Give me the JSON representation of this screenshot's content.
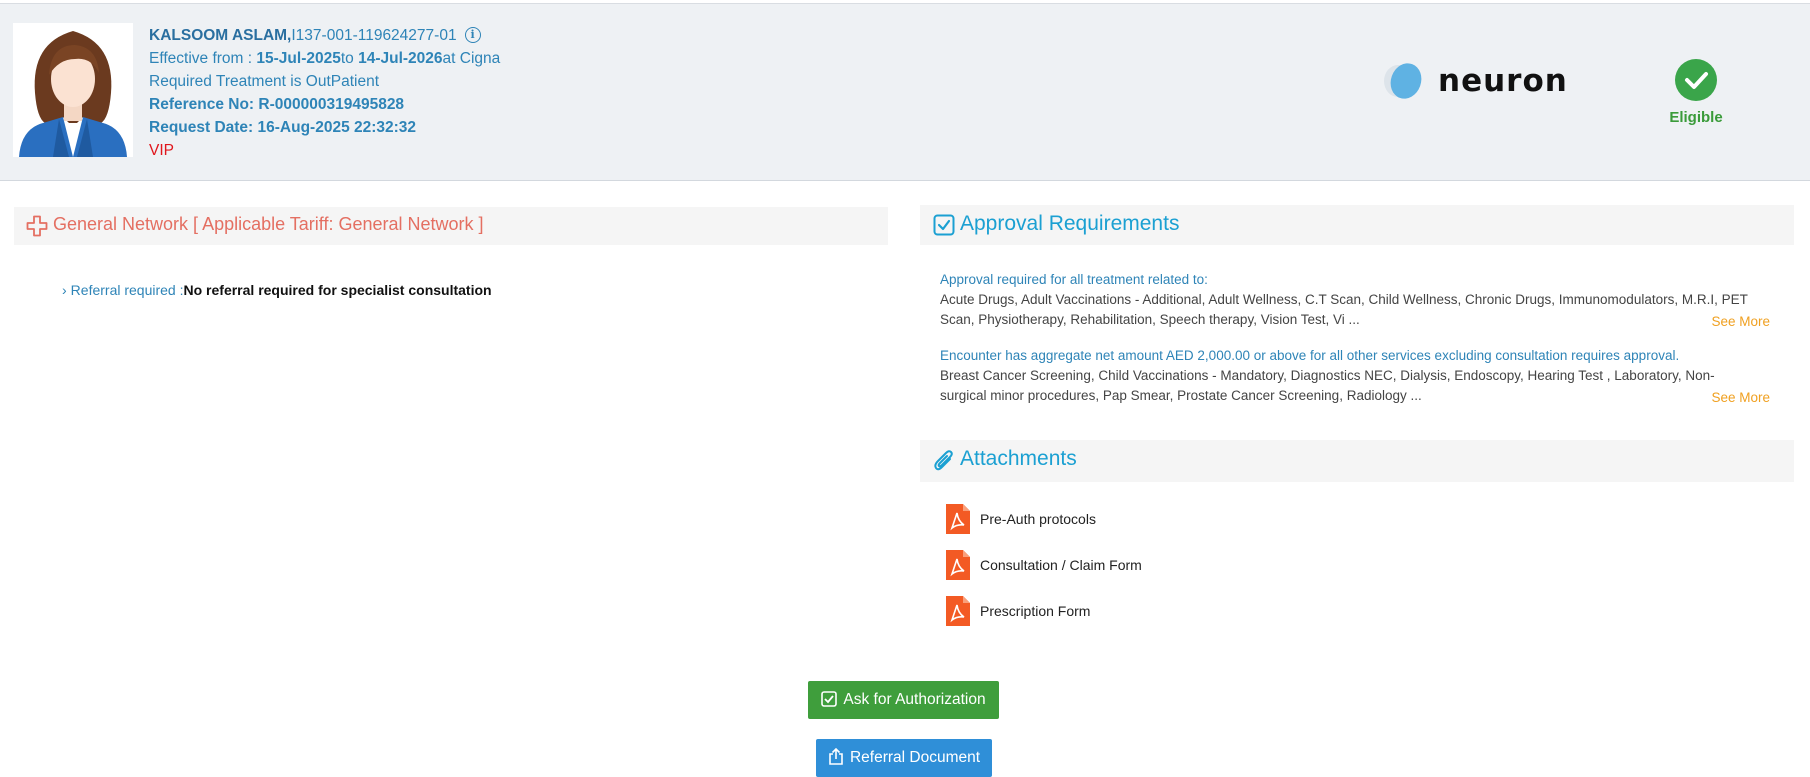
{
  "patient": {
    "name": "KALSOOM ASLAM,",
    "member_id": "I137-001-119624277-01",
    "effective_prefix": "Effective from : ",
    "effective_from": "15-Jul-2025",
    "to_word": "to ",
    "effective_to": "14-Jul-2026",
    "at_text": "at Cigna",
    "treatment": "Required Treatment is OutPatient",
    "reference": "Reference No: R-000000319495828",
    "request_date": "Request Date: 16-Aug-2025 22:32:32",
    "vip": "VIP"
  },
  "brand": {
    "name": "neuron"
  },
  "eligibility": {
    "status": "Eligible",
    "color": "#3aa54a"
  },
  "network": {
    "title": "General Network [ Applicable Tariff: General Network ]",
    "referral_label": "Referral required :",
    "referral_value": "No referral required for specialist consultation"
  },
  "approval": {
    "title": "Approval Requirements",
    "items": [
      {
        "header": "Approval required for all treatment related to:",
        "body": "Acute Drugs, Adult Vaccinations - Additional, Adult Wellness, C.T Scan, Child Wellness, Chronic Drugs, Immunomodulators, M.R.I, PET Scan, Physiotherapy, Rehabilitation, Speech therapy, Vision Test, Vi ...",
        "see_more": "See More"
      },
      {
        "header": "Encounter has aggregate net amount AED 2,000.00 or above for all other services excluding consultation requires approval.",
        "body": "Breast Cancer Screening, Child Vaccinations - Mandatory, Diagnostics NEC, Dialysis, Endoscopy, Hearing Test , Laboratory, Non-surgical minor procedures, Pap Smear, Prostate Cancer Screening, Radiology ...",
        "see_more": "See More"
      }
    ]
  },
  "attachments": {
    "title": "Attachments",
    "items": [
      "Pre-Auth protocols",
      "Consultation / Claim Form",
      "Prescription Form"
    ]
  },
  "actions": {
    "ask_auth": "Ask for Authorization",
    "referral_doc": "Referral Document"
  }
}
